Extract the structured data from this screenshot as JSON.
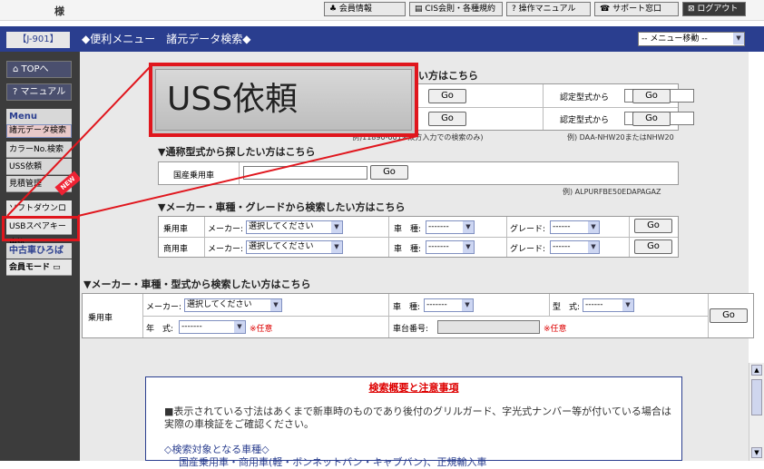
{
  "top": {
    "sama": "様",
    "nav": [
      "♣ 会員情報",
      "CIS会則・各種規約",
      "操作マニュアル",
      "サポート窓口",
      "ログアウト"
    ]
  },
  "header": {
    "code": "【J-901】",
    "title": "◆便利メニュー　諸元データ検索◆",
    "menu_select": "-- メニュー移動 --"
  },
  "sidebar": {
    "top_btn": "TOPへ",
    "manual_btn": "マニュアル",
    "menu_header": "Menu",
    "items": [
      "諸元データ検索",
      "カラーNo.検索",
      "USS依頼",
      "見積管理"
    ],
    "new_tag": "NEW",
    "soft": "ソフトダウンロード",
    "uss_spare": "USBスペアキー申込",
    "used_header": "中古車ひろば",
    "member_mode": "会員モード"
  },
  "popup": {
    "text": "USS依頼"
  },
  "sec1": {
    "title_tail": "い方はこちら",
    "go": "Go",
    "nintei": "認定型式から",
    "note_left": "例)11890-001※双方入力での検索のみ)",
    "note_right": "例) DAA-NHW20またはNHW20"
  },
  "sec2": {
    "title": "▼通称型式から探したい方はこちら",
    "label": "国産乗用車",
    "go": "Go",
    "example": "例) ALPURFBE50EDAPAGAZ"
  },
  "sec3": {
    "title": "▼メーカー・車種・グレードから検索したい方はこちら",
    "rows": [
      {
        "type": "乗用車",
        "maker_label": "メーカー:",
        "maker": "選択してください",
        "model_label": "車　種:",
        "model": "-------",
        "grade_label": "グレード:",
        "grade": "------",
        "go": "Go"
      },
      {
        "type": "商用車",
        "maker_label": "メーカー:",
        "maker": "選択してください",
        "model_label": "車　種:",
        "model": "-------",
        "grade_label": "グレード:",
        "grade": "------",
        "go": "Go"
      }
    ]
  },
  "sec4": {
    "title": "▼メーカー・車種・型式から検索したい方はこちら",
    "type": "乗用車",
    "maker_label": "メーカー:",
    "maker": "選択してください",
    "model_label": "車　種:",
    "model": "-------",
    "katashiki_label": "型　式:",
    "katashiki": "------",
    "year_label": "年　式:",
    "year": "-------",
    "optional": "※任意",
    "chassis_label": "車台番号:",
    "optional2": "※任意",
    "go": "Go"
  },
  "notice": {
    "title": "検索概要と注意事項",
    "p1": "■表示されている寸法はあくまで新車時のものであり後付のグリルガード、字光式ナンバー等が付いている場合は実際の車検証をご確認ください。",
    "p2": "◇検索対象となる車種◇",
    "p3": "国産乗用車・商用車(軽・ボンネットバン・キャブバン)、正規輸入車"
  },
  "colors": {
    "header": "#2a3e8f",
    "highlight": "#e0161d"
  }
}
